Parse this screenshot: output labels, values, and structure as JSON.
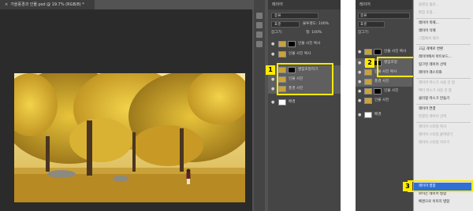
{
  "left": {
    "doc_tab": "가을풍경과 인물.psd @ 19.7% (RGB/8) *",
    "panel_title": "레이어",
    "filter_label": "종류",
    "blend_mode": "표준",
    "opacity_label": "불투명도: 100%",
    "lock_label": "잠그기:",
    "fill_label": "칠: 100%",
    "layers": [
      {
        "name": "인물 사진 복사",
        "selected": false,
        "mask": true
      },
      {
        "name": "인물 사진 복사",
        "selected": false,
        "mask": false
      },
      {
        "name": "명암조정하기",
        "selected": true,
        "mask": true
      },
      {
        "name": "인물 사진",
        "selected": true,
        "mask": false
      },
      {
        "name": "풍경 사진",
        "selected": true,
        "mask": false
      },
      {
        "name": "배경",
        "selected": false,
        "mask": false
      }
    ],
    "callout": "1"
  },
  "right": {
    "panel_title": "레이어",
    "filter_label": "종류",
    "blend_mode": "표준",
    "lock_label": "잠그기:",
    "layers": [
      {
        "name": "인물 사진 복사",
        "selected": false,
        "mask": true
      },
      {
        "name": "명암조정",
        "selected": true,
        "mask": true
      },
      {
        "name": "인물 사진 복사",
        "selected": true,
        "mask": false
      },
      {
        "name": "풍경 사진",
        "selected": true,
        "mask": false
      },
      {
        "name": "인물 사진",
        "selected": false,
        "mask": true
      },
      {
        "name": "인물 사진",
        "selected": false,
        "mask": false
      },
      {
        "name": "배경",
        "selected": false,
        "mask": false
      }
    ],
    "callouts": [
      "2",
      "3"
    ],
    "menu_items": [
      {
        "label": "블렌딩 옵션...",
        "dim": true
      },
      {
        "label": "편집 조정...",
        "dim": true
      },
      {
        "label": "레이어 복제...",
        "dim": false
      },
      {
        "label": "레이어 삭제",
        "dim": false
      },
      {
        "label": "그룹에서 제거",
        "dim": true
      },
      {
        "label": "고급 개체로 변환",
        "dim": false
      },
      {
        "label": "레이어에서 아트보드...",
        "dim": false
      },
      {
        "label": "링크된 레이어 선택",
        "dim": false
      },
      {
        "label": "레이어 래스터화",
        "dim": false
      },
      {
        "label": "레이어 마스크 사용 안 함",
        "dim": true
      },
      {
        "label": "벡터 마스크 사용 안 함",
        "dim": true
      },
      {
        "label": "클리핑 마스크 만들기",
        "dim": false
      },
      {
        "label": "레이어 연결",
        "dim": false
      },
      {
        "label": "연결된 레이어 선택",
        "dim": true
      },
      {
        "label": "레이어 스타일 복사",
        "dim": true
      },
      {
        "label": "레이어 스타일 붙여넣기",
        "dim": true
      },
      {
        "label": "레이어 스타일 지우기",
        "dim": true
      },
      {
        "label": "레이어 병합",
        "dim": false,
        "active": true
      },
      {
        "label": "보이는 레이어 병합",
        "dim": false
      },
      {
        "label": "배경으로 이미지 병합",
        "dim": false
      },
      {
        "label": "색상 없음",
        "dim": false
      }
    ]
  }
}
